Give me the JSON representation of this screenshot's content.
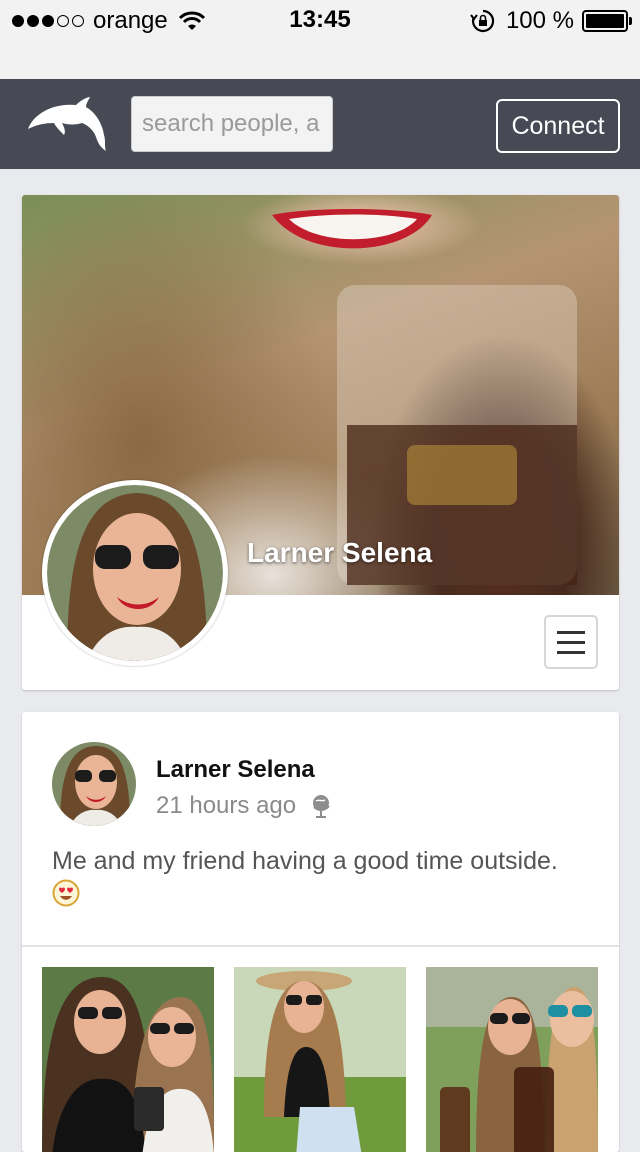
{
  "status_bar": {
    "carrier": "orange",
    "time": "13:45",
    "battery": "100 %"
  },
  "nav": {
    "logo_icon": "dolphin-icon",
    "search_placeholder": "search people, a",
    "connect_label": "Connect"
  },
  "profile": {
    "name": "Larner Selena",
    "menu_icon": "hamburger-icon"
  },
  "post": {
    "author": "Larner Selena",
    "time": "21 hours ago",
    "visibility_icon": "globe-icon",
    "text": "Me and my friend having a good time outside.",
    "emoji_icon": "heart-eyes-emoji-icon"
  },
  "colors": {
    "navbar": "#474a55",
    "background": "#e9eaed"
  }
}
